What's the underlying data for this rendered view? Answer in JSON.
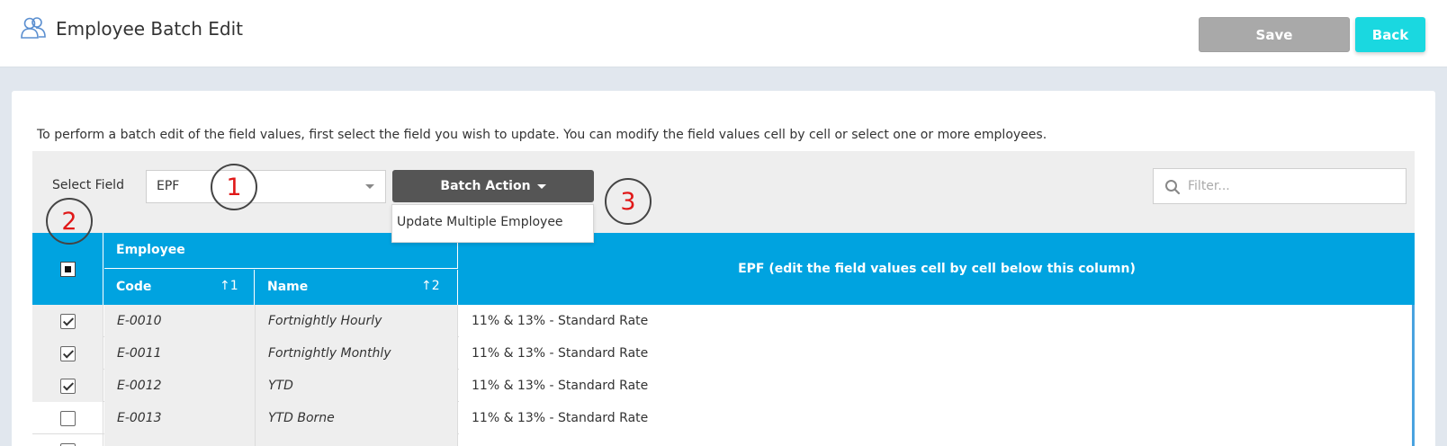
{
  "header": {
    "title": "Employee Batch Edit",
    "title_icon": "users-icon",
    "save_label": "Save",
    "back_label": "Back"
  },
  "instructions": "To perform a batch edit of the field values, first select the field you wish to update. You can modify the field values cell by cell or select one or more employees.",
  "toolbar": {
    "select_field_label": "Select Field",
    "selected_field": "EPF",
    "batch_action_label": "Batch Action",
    "batch_menu_items": [
      "Update Multiple Employee"
    ],
    "filter_placeholder": "Filter..."
  },
  "markers": [
    "1",
    "2",
    "3"
  ],
  "table": {
    "group_header": "Employee",
    "columns": {
      "code": "Code",
      "code_sort": "1",
      "name": "Name",
      "name_sort": "2",
      "epf": "EPF (edit the field values cell by cell below this column)"
    },
    "rows": [
      {
        "checked": true,
        "code": "E-0010",
        "name": "Fortnightly Hourly",
        "epf": "11% & 13% - Standard Rate"
      },
      {
        "checked": true,
        "code": "E-0011",
        "name": "Fortnightly Monthly",
        "epf": "11% & 13% - Standard Rate"
      },
      {
        "checked": true,
        "code": "E-0012",
        "name": "YTD",
        "epf": "11% & 13% - Standard Rate"
      },
      {
        "checked": false,
        "code": "E-0013",
        "name": "YTD Borne",
        "epf": "11% & 13% - Standard Rate"
      }
    ]
  },
  "colors": {
    "header_blue": "#00a3e0",
    "back_button": "#1ad8e0",
    "save_button_disabled": "#a9a9a9",
    "batch_button": "#555555",
    "marker_digit": "#e01818"
  }
}
